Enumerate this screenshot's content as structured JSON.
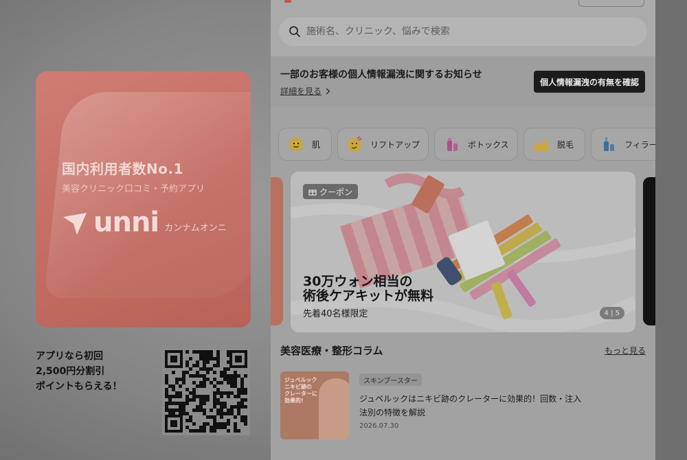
{
  "promo": {
    "headline": "国内利用者数No.1",
    "subtitle": "美容クリニック口コミ・予約アプリ",
    "brand": "unni",
    "brand_kana": "カンナムオンニ",
    "offer_lines": [
      "アプリなら初回",
      "2,500円分割引",
      "ポイントもらえる！"
    ]
  },
  "search": {
    "placeholder": "施術名、クリニック、悩みで検索"
  },
  "notice": {
    "title": "一部のお客様の個人情報漏洩に関するお知らせ",
    "link_label": "詳細を見る",
    "button_label": "個人情報漏洩の有無を確認"
  },
  "categories": [
    {
      "label": "肌",
      "icon": "face-icon"
    },
    {
      "label": "リフトアップ",
      "icon": "lift-face-icon"
    },
    {
      "label": "ボトックス",
      "icon": "vial-icon"
    },
    {
      "label": "脱毛",
      "icon": "sparkle-icon"
    },
    {
      "label": "フィラー",
      "icon": "syringe-icon"
    }
  ],
  "banner": {
    "badge": "クーポン",
    "title_line1": "30万ウォン相当の",
    "title_line2": "術後ケアキットが無料",
    "subtitle": "先着40名様限定",
    "pager": "4 | 5"
  },
  "column": {
    "title": "美容医療・整形コラム",
    "more_label": "もっと見る",
    "article": {
      "tag": "スキンブースター",
      "title": "ジュベルックはニキビ跡のクレーターに効果的！回数・注入法別の特徴を解説",
      "date": "2026.07.30",
      "thumb_caption": "ジュベルック\nニキビ跡の\nクレーターに\n効果的!"
    }
  },
  "colors": {
    "accent": "#c0584c",
    "dark_button": "#1c1c1c"
  }
}
